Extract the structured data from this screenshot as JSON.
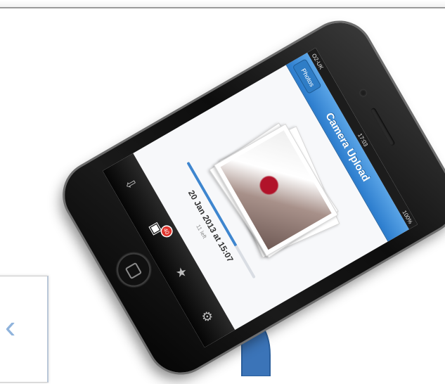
{
  "status_bar": {
    "carrier": "O2-UK",
    "time": "17:03",
    "battery": "100%"
  },
  "nav": {
    "back_label": "Photos",
    "title": "Camera Upload"
  },
  "upload": {
    "date_text": "20 Jan 2013 at 15:07",
    "sub_text": "11 left",
    "progress": 0.72
  },
  "tabs": [
    {
      "icon": "folder-icon",
      "glyph": "⇩"
    },
    {
      "icon": "photos-icon",
      "glyph": "▣",
      "badge": "40"
    },
    {
      "icon": "star-icon",
      "glyph": "★"
    },
    {
      "icon": "gear-icon",
      "glyph": "⚙"
    }
  ],
  "colors": {
    "nav_blue": "#2b7ccd",
    "arrow_blue": "#3b74b8",
    "badge_red": "#e0342c"
  }
}
